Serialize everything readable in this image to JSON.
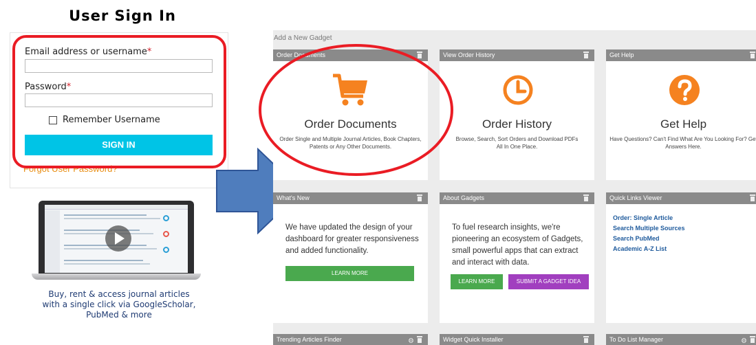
{
  "signin": {
    "title": "User Sign In",
    "email_label": "Email address or username",
    "password_label": "Password",
    "required_mark": "*",
    "remember_label": "Remember Username",
    "signin_button": "SIGN IN",
    "forgot_link": "Forgot User Password?"
  },
  "promo": {
    "line1": "Buy, rent & access journal articles",
    "line2": "with a single click via GoogleScholar,",
    "line3": "PubMed & more"
  },
  "dashboard": {
    "add_gadget": "Add a New Gadget",
    "gadgets": [
      {
        "header": "Order Documents",
        "icon": "shopping-cart-icon",
        "title": "Order Documents",
        "desc_line1": "Order Single and Multiple Journal Articles, Book Chapters,",
        "desc_line2": "Patents or Any Other Documents."
      },
      {
        "header": "View Order History",
        "icon": "clock-icon",
        "title": "Order History",
        "desc_line1": "Browse, Search, Sort Orders and Download PDFs",
        "desc_line2": "All In One Place."
      },
      {
        "header": "Get Help",
        "icon": "question-icon",
        "title": "Get Help",
        "desc_line1": "Have Questions? Can't Find What Are You Looking For? Get",
        "desc_line2": "Answers Here."
      },
      {
        "header": "What's New",
        "text": "We have updated the design of your dashboard for greater responsiveness and added functionality.",
        "button": "LEARN MORE"
      },
      {
        "header": "About Gadgets",
        "text": "To fuel research insights, we're pioneering an ecosystem of Gadgets, small powerful apps that can extract and interact with data.",
        "button": "LEARN MORE",
        "button2": "SUBMIT A GADGET IDEA"
      },
      {
        "header": "Quick Links Viewer",
        "links": [
          "Order: Single Article",
          "Search Multiple Sources",
          "Search PubMed",
          "Academic A-Z List"
        ]
      },
      {
        "header": "Trending Articles Finder"
      },
      {
        "header": "Widget Quick Installer"
      },
      {
        "header": "To Do List Manager"
      }
    ]
  },
  "colors": {
    "accent_orange": "#f58220",
    "signin_cyan": "#00c4e6",
    "highlight_red": "#ea1c24",
    "arrow_blue": "#4f7dbd"
  }
}
